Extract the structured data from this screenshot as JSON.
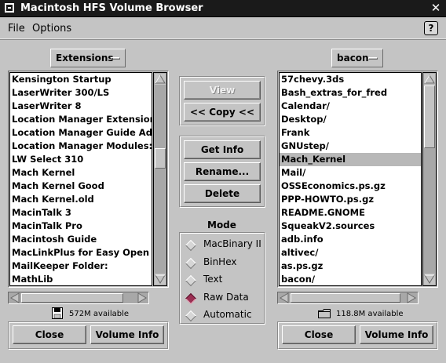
{
  "window": {
    "title": "Macintosh HFS Volume Browser",
    "close_glyph": "✕"
  },
  "menu": {
    "file": "File",
    "options": "Options",
    "help": "?"
  },
  "left": {
    "volume": "Extensions",
    "items": [
      "Kensington Startup",
      "LaserWriter 300/LS",
      "LaserWriter 8",
      "Location Manager Extension",
      "Location Manager Guide Addtu",
      "Location Manager Modules:",
      "LW Select 310",
      "Mach Kernel",
      "Mach Kernel Good",
      "Mach Kernel.old",
      "MacinTalk 3",
      "MacinTalk Pro",
      "Macintosh Guide",
      "MacLinkPlus for Easy Open",
      "MailKeeper Folder:",
      "MathLib"
    ],
    "available": "572M available",
    "close": "Close",
    "volume_info": "Volume Info"
  },
  "right": {
    "volume": "bacon",
    "items": [
      "57chevy.3ds",
      "Bash_extras_for_fred",
      "Calendar/",
      "Desktop/",
      "Frank",
      "GNUstep/",
      "Mach_Kernel",
      "Mail/",
      "OSSEconomics.ps.gz",
      "PPP-HOWTO.ps.gz",
      "README.GNOME",
      "SqueakV2.sources",
      "adb.info",
      "altivec/",
      "as.ps.gz",
      "bacon/"
    ],
    "selected_index": 6,
    "available": "118.8M available",
    "close": "Close",
    "volume_info": "Volume Info"
  },
  "center": {
    "view": "View",
    "copy": "<< Copy <<",
    "get_info": "Get Info",
    "rename": "Rename...",
    "delete": "Delete",
    "mode_label": "Mode",
    "modes": [
      "MacBinary II",
      "BinHex",
      "Text",
      "Raw Data",
      "Automatic"
    ],
    "selected_mode": "Raw Data"
  },
  "icons": {
    "left_available": "floppy-disk-icon",
    "right_available": "folder-icon"
  }
}
